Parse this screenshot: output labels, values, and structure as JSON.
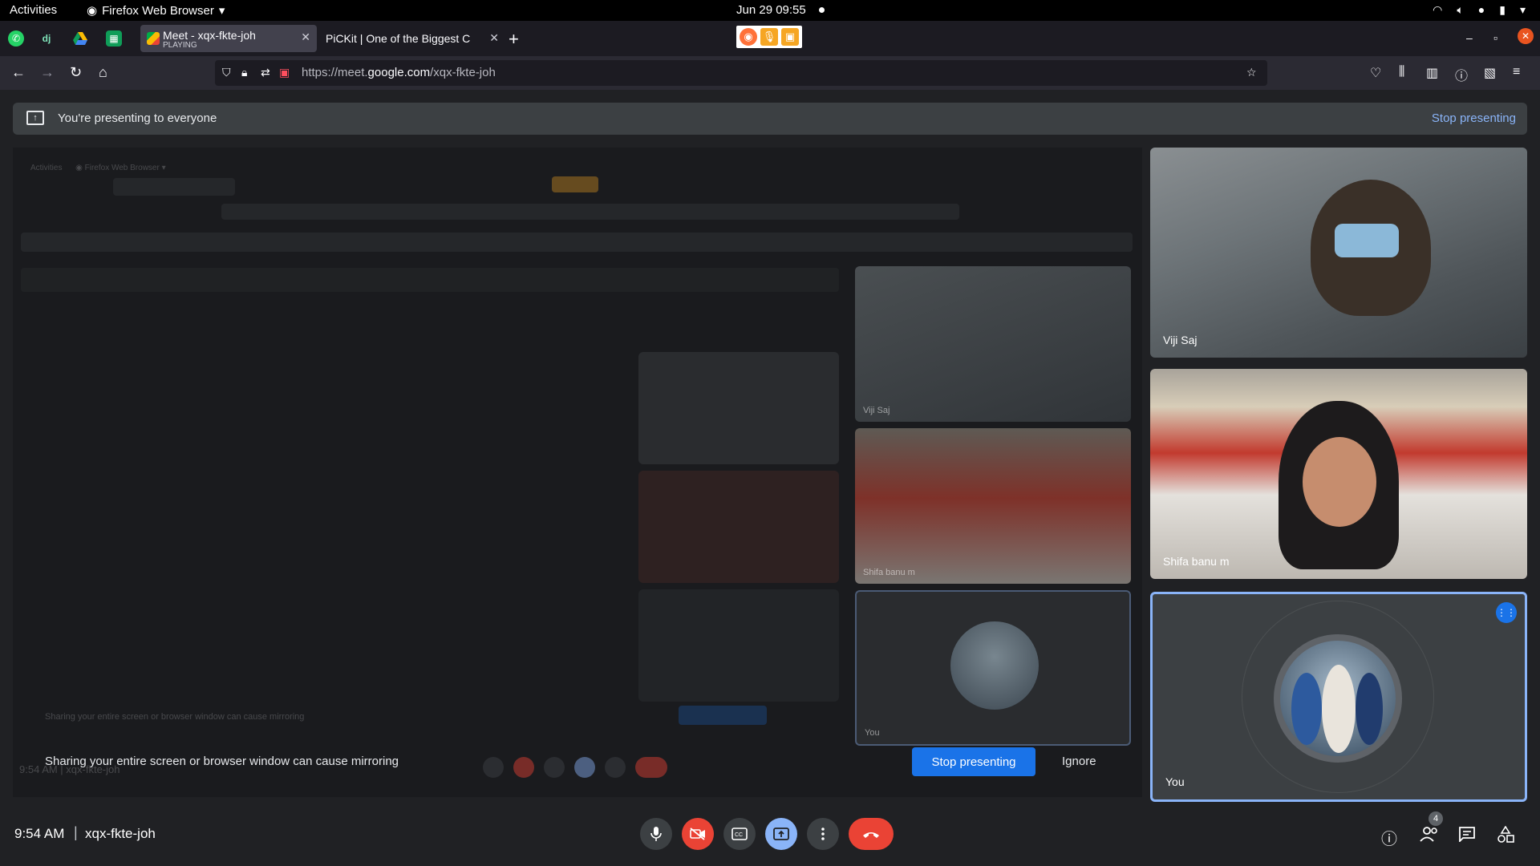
{
  "system_bar": {
    "activities": "Activities",
    "app_menu": "Firefox Web Browser",
    "clock": "Jun 29  09:55"
  },
  "browser": {
    "tabs": [
      {
        "title": "Meet - xqx-fkte-joh",
        "subtitle": "PLAYING"
      },
      {
        "title": "PiCKit | One of the Biggest C"
      }
    ],
    "url_prefix": "https://meet.",
    "url_domain": "google.com",
    "url_path": "/xqx-fkte-joh"
  },
  "banner": {
    "message": "You're presenting to everyone",
    "stop_label": "Stop presenting"
  },
  "presentation": {
    "mirror_warning": "Sharing your entire screen or browser window can cause mirroring",
    "stop_button": "Stop presenting",
    "ignore_button": "Ignore",
    "inner_tile_labels": [
      "Viji Saj",
      "Shifa banu m",
      "You"
    ],
    "inner_time": "9:54 AM  |  xqx-fkte-joh"
  },
  "participants": [
    {
      "name": "Viji Saj"
    },
    {
      "name": "Shifa banu m"
    },
    {
      "name": "You"
    }
  ],
  "meeting": {
    "time": "9:54 AM",
    "separator": "|",
    "code": "xqx-fkte-joh",
    "people_count": "4"
  },
  "colors": {
    "accent_blue": "#1a73e8",
    "link_blue": "#8ab4f8",
    "danger_red": "#ea4335",
    "surface": "#3c4043"
  }
}
